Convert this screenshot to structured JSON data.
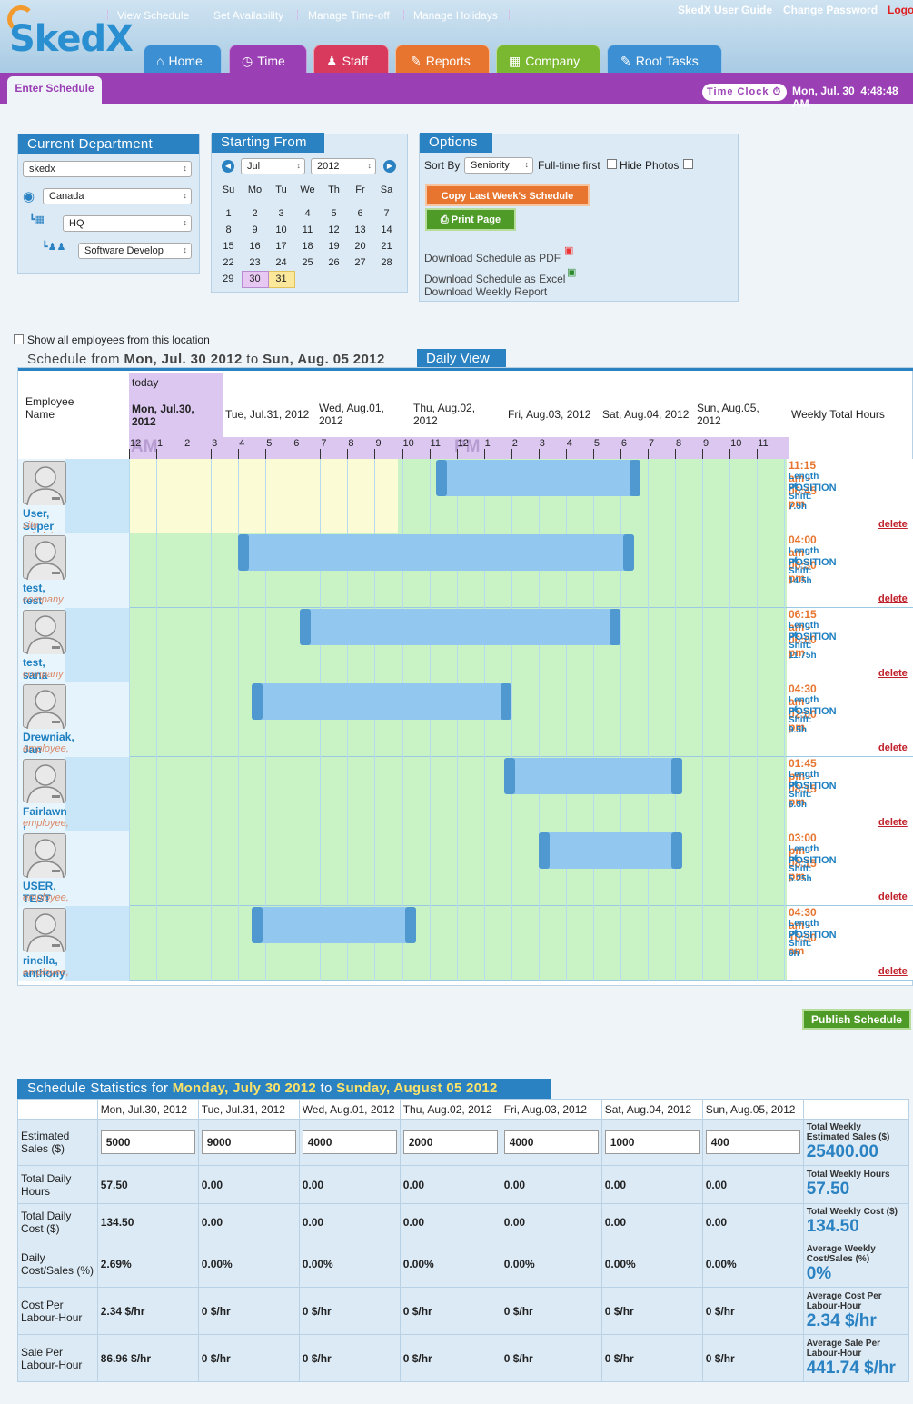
{
  "app": {
    "logo": "SkedX",
    "links": [
      "SkedX User Guide",
      "Change Password",
      "Logout"
    ]
  },
  "tabs": [
    {
      "label": "Home",
      "color": "#3b8fd2",
      "icon": "house-icon"
    },
    {
      "label": "Time",
      "color": "#9a3fb4",
      "icon": "clock-icon"
    },
    {
      "label": "Staff",
      "color": "#d83a5d",
      "icon": "person-icon"
    },
    {
      "label": "Reports",
      "color": "#e8752f",
      "icon": "document-icon"
    },
    {
      "label": "Company",
      "color": "#7ab832",
      "icon": "building-icon"
    },
    {
      "label": "Root Tasks",
      "color": "#3b8fd2",
      "icon": "tasks-icon"
    }
  ],
  "subnav": [
    "Enter Schedule",
    "View Schedule",
    "Set Availability",
    "Manage Time-off",
    "Manage Holidays"
  ],
  "timeclock": {
    "label": "Time Clock",
    "date": "Mon, Jul. 30",
    "time": "4:48:48 AM"
  },
  "dept": {
    "title": "Current Department",
    "company": "skedx",
    "country": "Canada",
    "office": "HQ",
    "team": "Software Develop"
  },
  "cal": {
    "title": "Starting From",
    "month": "Jul",
    "year": "2012",
    "weekdays": [
      "Su",
      "Mo",
      "Tu",
      "We",
      "Th",
      "Fr",
      "Sa"
    ],
    "weeks": [
      [
        "1",
        "2",
        "3",
        "4",
        "5",
        "6",
        "7"
      ],
      [
        "8",
        "9",
        "10",
        "11",
        "12",
        "13",
        "14"
      ],
      [
        "15",
        "16",
        "17",
        "18",
        "19",
        "20",
        "21"
      ],
      [
        "22",
        "23",
        "24",
        "25",
        "26",
        "27",
        "28"
      ],
      [
        "29",
        "30",
        "31",
        "",
        "",
        "",
        ""
      ]
    ]
  },
  "options": {
    "title": "Options",
    "sort_label": "Sort By",
    "sort_value": "Seniority",
    "fulltime_label": "Full-time first",
    "photos_label": "Hide Photos",
    "copy_btn": "Copy Last Week's Schedule",
    "print_btn": "Print Page",
    "dl_pdf": "Download Schedule as PDF",
    "dl_excel": "Download Schedule as Excel",
    "dl_report": "Download Weekly Report"
  },
  "show_all": "Show all employees from this location",
  "schedule": {
    "prefix": "Schedule from",
    "start": "Mon, Jul. 30 2012",
    "to": "to",
    "end": "Sun, Aug. 05 2012",
    "view": "Daily View",
    "emp_header": "Employee Name",
    "today": "today",
    "days": [
      "Mon, Jul.30, 2012",
      "Tue, Jul.31, 2012",
      "Wed, Aug.01, 2012",
      "Thu, Aug.02, 2012",
      "Fri, Aug.03, 2012",
      "Sat, Aug.04, 2012",
      "Sun, Aug.05, 2012"
    ],
    "weekly_header": "Weekly Total Hours",
    "am": "AM",
    "pm": "PM",
    "hours": [
      "12",
      "1",
      "2",
      "3",
      "4",
      "5",
      "6",
      "7",
      "8",
      "9",
      "10",
      "11",
      "12",
      "1",
      "2",
      "3",
      "4",
      "5",
      "6",
      "7",
      "8",
      "9",
      "10",
      "11"
    ],
    "shift_length_label": "Length of Shift:",
    "position_label": "POSITION",
    "delete_label": "delete",
    "employees": [
      {
        "name": "User, Super",
        "role": "site administrator,",
        "time": "11:15 am - 06:45 pm",
        "length": "7.5h",
        "start": 11.25,
        "end": 18.75
      },
      {
        "name": "test, test",
        "role": "company manager,",
        "time": "04:00 am - 06:30 pm",
        "length": "14.5h",
        "start": 4.0,
        "end": 18.5
      },
      {
        "name": "test, sana",
        "role": "company manager,",
        "time": "06:15 am - 06:00 pm",
        "length": "11.75h",
        "start": 6.25,
        "end": 18.0
      },
      {
        "name": "Drewniak, Jan",
        "role": "employee,",
        "time": "04:30 am - 02:00 pm",
        "length": "9.5h",
        "start": 4.5,
        "end": 14.0
      },
      {
        "name": "Fairlawn , Michael",
        "role": "employee,",
        "time": "01:45 pm - 08:15 pm",
        "length": "6.5h",
        "start": 13.75,
        "end": 20.25
      },
      {
        "name": "USER, TEST",
        "role": "employee,",
        "time": "03:00 pm - 08:15 pm",
        "length": "5.25h",
        "start": 15.0,
        "end": 20.25
      },
      {
        "name": "rinella, anthony",
        "role": "employee,",
        "time": "04:30 am - 10:30 am",
        "length": "6h",
        "start": 4.5,
        "end": 10.5
      }
    ],
    "publish_btn": "Publish Schedule"
  },
  "stats": {
    "prefix": "Schedule Statistics for",
    "start": "Monday, July 30 2012",
    "to": "to",
    "end": "Sunday, August 05 2012",
    "days": [
      "Mon, Jul.30, 2012",
      "Tue, Jul.31, 2012",
      "Wed, Aug.01, 2012",
      "Thu, Aug.02, 2012",
      "Fri, Aug.03, 2012",
      "Sat, Aug.04, 2012",
      "Sun, Aug.05, 2012"
    ],
    "rows": [
      {
        "label": "Estimated Sales ($)",
        "inputs": true,
        "values": [
          "5000",
          "9000",
          "4000",
          "2000",
          "4000",
          "1000",
          "400"
        ],
        "total_label": "Total Weekly Estimated Sales ($)",
        "total": "25400.00"
      },
      {
        "label": "Total Daily Hours",
        "values": [
          "57.50",
          "0.00",
          "0.00",
          "0.00",
          "0.00",
          "0.00",
          "0.00"
        ],
        "total_label": "Total Weekly Hours",
        "total": "57.50"
      },
      {
        "label": "Total Daily Cost ($)",
        "values": [
          "134.50",
          "0.00",
          "0.00",
          "0.00",
          "0.00",
          "0.00",
          "0.00"
        ],
        "total_label": "Total Weekly Cost ($)",
        "total": "134.50"
      },
      {
        "label": "Daily Cost/Sales (%)",
        "values": [
          "2.69%",
          "0.00%",
          "0.00%",
          "0.00%",
          "0.00%",
          "0.00%",
          "0.00%"
        ],
        "total_label": "Average Weekly Cost/Sales (%)",
        "total": "0%"
      },
      {
        "label": "Cost Per Labour-Hour",
        "values": [
          "2.34 $/hr",
          "0 $/hr",
          "0 $/hr",
          "0 $/hr",
          "0 $/hr",
          "0 $/hr",
          "0 $/hr"
        ],
        "total_label": "Average Cost Per Labour-Hour",
        "total": "2.34 $/hr"
      },
      {
        "label": "Sale Per Labour-Hour",
        "values": [
          "86.96 $/hr",
          "0 $/hr",
          "0 $/hr",
          "0 $/hr",
          "0 $/hr",
          "0 $/hr",
          "0 $/hr"
        ],
        "total_label": "Average Sale Per Labour-Hour",
        "total": "441.74 $/hr"
      }
    ]
  }
}
